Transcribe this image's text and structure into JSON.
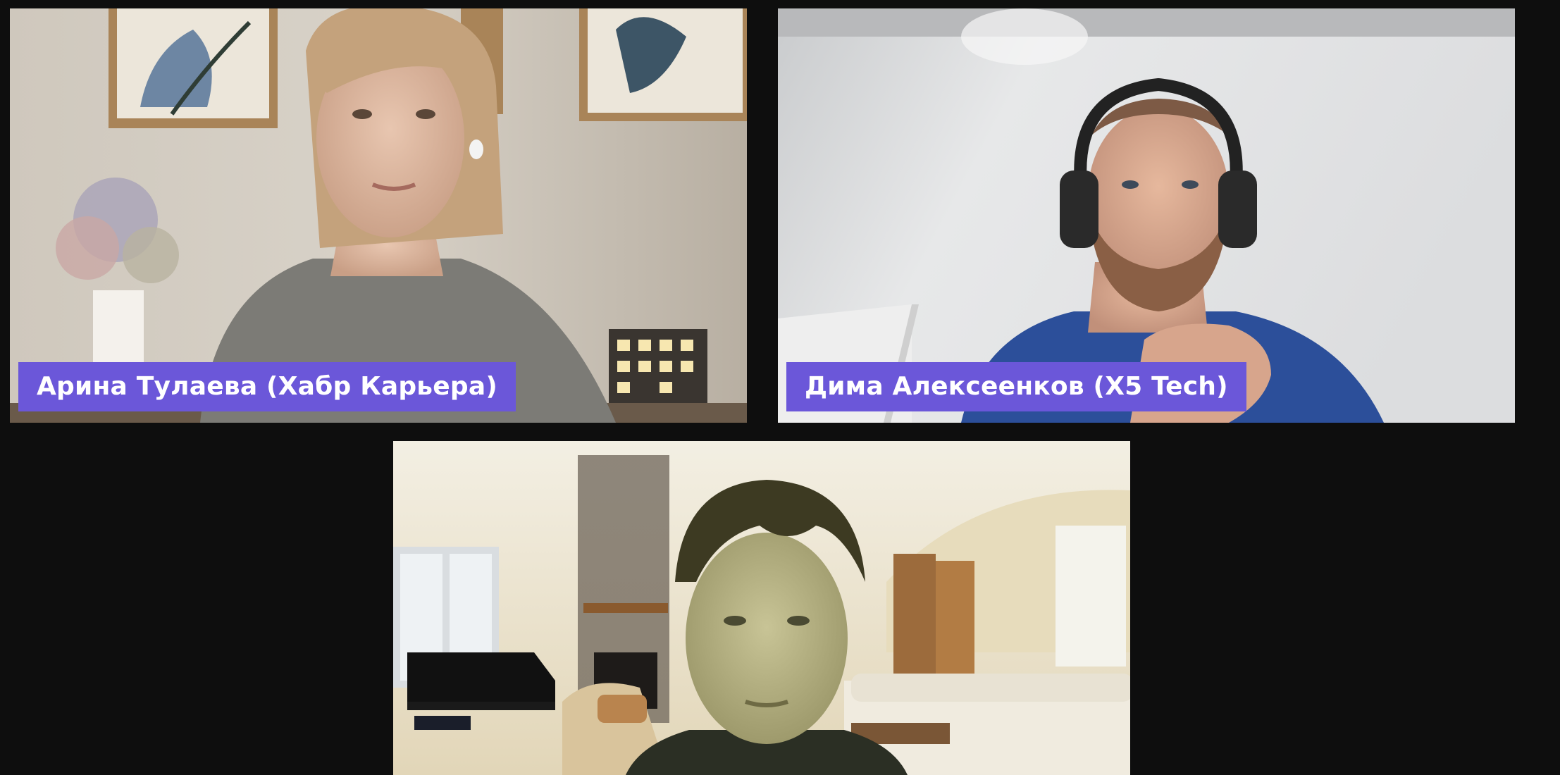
{
  "participants": [
    {
      "display_name": "Арина Тулаева (Хабр Карьера)"
    },
    {
      "display_name": "Дима Алексеенков (X5 Tech)"
    },
    {
      "display_name": ""
    }
  ],
  "colors": {
    "background": "#0e0e0e",
    "name_tag": "#6b57d9",
    "name_tag_text": "#ffffff"
  }
}
